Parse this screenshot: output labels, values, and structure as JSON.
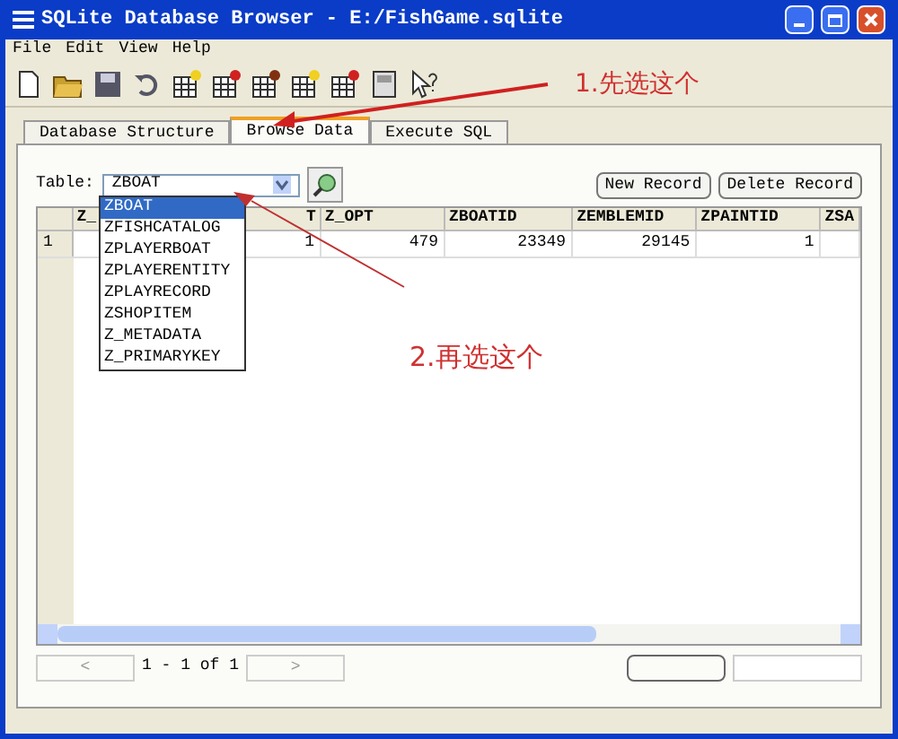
{
  "window": {
    "title": "SQLite Database Browser - E:/FishGame.sqlite"
  },
  "menu": [
    "File",
    "Edit",
    "View",
    "Help"
  ],
  "tabs": [
    {
      "label": "Database Structure",
      "selected": false
    },
    {
      "label": "Browse Data",
      "selected": true
    },
    {
      "label": "Execute SQL",
      "selected": false
    }
  ],
  "table_picker": {
    "label": "Table:",
    "value": "ZBOAT",
    "options": [
      {
        "label": "ZBOAT",
        "selected": true
      },
      {
        "label": "ZFISHCATALOG",
        "selected": false
      },
      {
        "label": "ZPLAYERBOAT",
        "selected": false
      },
      {
        "label": "ZPLAYERENTITY",
        "selected": false
      },
      {
        "label": "ZPLAYRECORD",
        "selected": false
      },
      {
        "label": "ZSHOPITEM",
        "selected": false
      },
      {
        "label": "Z_METADATA",
        "selected": false
      },
      {
        "label": "Z_PRIMARYKEY",
        "selected": false
      }
    ]
  },
  "buttons": [
    "New Record",
    "Delete Record"
  ],
  "grid": {
    "columns": [
      "Z_",
      "T",
      "Z_OPT",
      "ZBOATID",
      "ZEMBLEMID",
      "ZPAINTID",
      "ZSA"
    ],
    "rows": [
      {
        "number": "1",
        "cells": [
          "",
          "1",
          "479",
          "23349",
          "29145",
          "1",
          ""
        ]
      }
    ]
  },
  "pager": {
    "prev": "<",
    "status": "1 - 1 of 1",
    "next": ">"
  },
  "annotations": [
    "1.先选这个",
    "2.再选这个"
  ]
}
